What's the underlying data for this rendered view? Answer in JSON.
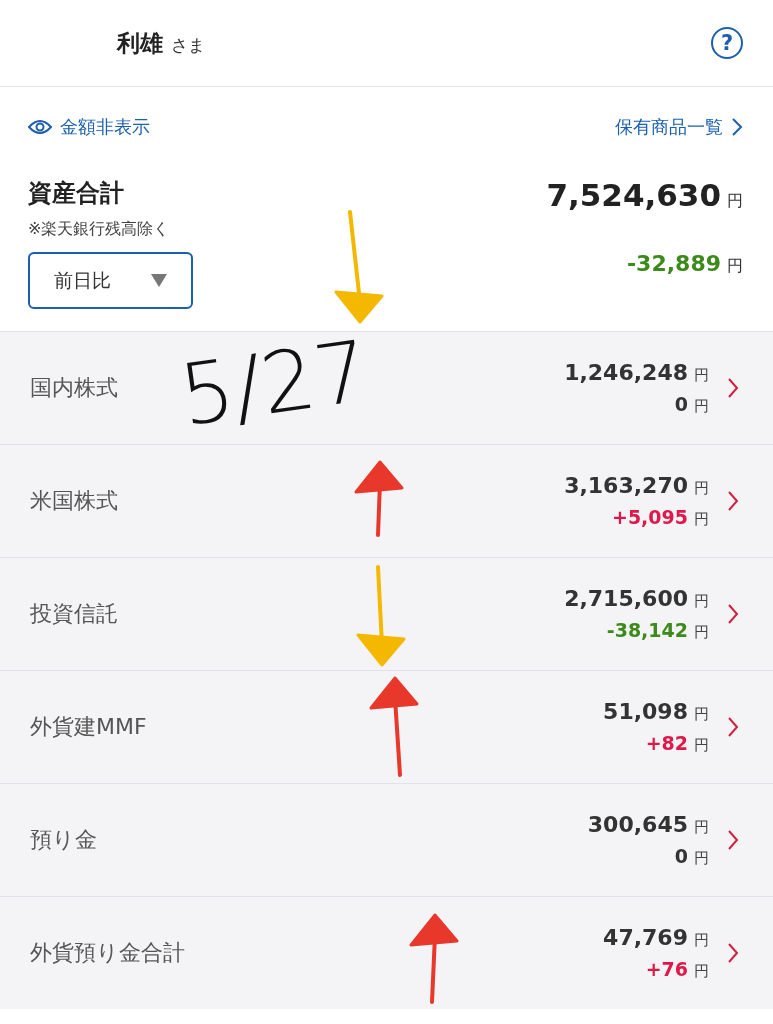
{
  "header": {
    "name": "利雄",
    "honorific": "さま",
    "help": "?"
  },
  "summary": {
    "hide_amounts": "金額非表示",
    "holdings_link": "保有商品一覧",
    "title": "資産合計",
    "note": "※楽天銀行残高除く",
    "period_select": "前日比",
    "total": "7,524,630",
    "total_unit": "円",
    "change": "-32,889",
    "change_unit": "円"
  },
  "rows": [
    {
      "label": "国内株式",
      "value": "1,246,248",
      "value_unit": "円",
      "change": "0",
      "change_unit": "円",
      "color": "#333333"
    },
    {
      "label": "米国株式",
      "value": "3,163,270",
      "value_unit": "円",
      "change": "+5,095",
      "change_unit": "円",
      "color": "#e0184a"
    },
    {
      "label": "投資信託",
      "value": "2,715,600",
      "value_unit": "円",
      "change": "-38,142",
      "change_unit": "円",
      "color": "#3b8a1a"
    },
    {
      "label": "外貨建MMF",
      "value": "51,098",
      "value_unit": "円",
      "change": "+82",
      "change_unit": "円",
      "color": "#e0184a"
    },
    {
      "label": "預り金",
      "value": "300,645",
      "value_unit": "円",
      "change": "0",
      "change_unit": "円",
      "color": "#333333"
    },
    {
      "label": "外貨預り金合計",
      "value": "47,769",
      "value_unit": "円",
      "change": "+76",
      "change_unit": "円",
      "color": "#e0184a"
    }
  ],
  "annotations": [
    {
      "kind": "downarrow",
      "color": "#f5b800"
    },
    {
      "kind": "note",
      "text": "5/27",
      "color": "#111111"
    },
    {
      "kind": "uparrow",
      "color": "#e8382b"
    },
    {
      "kind": "downarrow",
      "color": "#f5b800"
    },
    {
      "kind": "uparrow",
      "color": "#e8382b"
    },
    {
      "kind": "uparrow",
      "color": "#e8382b"
    }
  ]
}
